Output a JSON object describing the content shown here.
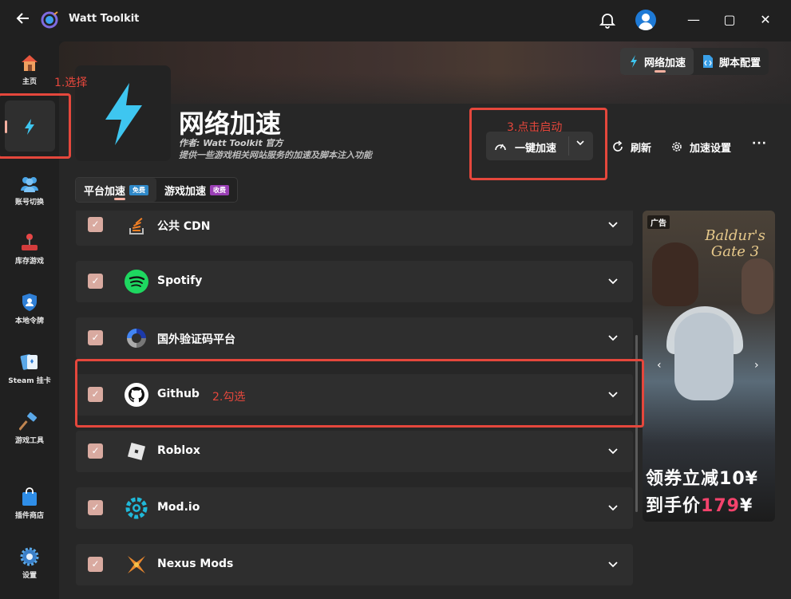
{
  "window": {
    "title": "Watt Toolkit",
    "controls": {
      "minimize": "—",
      "maximize": "▢",
      "close": "✕"
    }
  },
  "sidebar": {
    "items": [
      {
        "label": "主页",
        "icon": "home-icon"
      },
      {
        "label": "",
        "icon": "lightning-icon",
        "active": true
      },
      {
        "label": "账号切换",
        "icon": "users-icon"
      },
      {
        "label": "库存游戏",
        "icon": "joystick-icon"
      },
      {
        "label": "本地令牌",
        "icon": "shield-icon"
      },
      {
        "label": "Steam 挂卡",
        "icon": "cards-icon"
      },
      {
        "label": "游戏工具",
        "icon": "hammer-icon"
      },
      {
        "label": "插件商店",
        "icon": "shopping-bag-icon"
      },
      {
        "label": "设置",
        "icon": "gear-icon"
      }
    ]
  },
  "header": {
    "title": "网络加速",
    "author": "作者:  Watt Toolkit  官方",
    "description": "提供一些游戏相关网站服务的加速及脚本注入功能",
    "top_tabs": [
      {
        "label": "网络加速",
        "active": true
      },
      {
        "label": "脚本配置",
        "active": false
      }
    ],
    "accelerate_button": "一键加速",
    "refresh_button": "刷新",
    "settings_button": "加速设置",
    "more_button": "···"
  },
  "sub_tabs": [
    {
      "label": "平台加速",
      "badge": "免费",
      "active": true
    },
    {
      "label": "游戏加速",
      "badge": "收费",
      "active": false
    }
  ],
  "list": {
    "rows": [
      {
        "label": "公共 CDN",
        "checked": true,
        "icon": "stackoverflow-icon"
      },
      {
        "label": "Spotify",
        "checked": true,
        "icon": "spotify-icon"
      },
      {
        "label": "国外验证码平台",
        "checked": true,
        "icon": "recaptcha-icon"
      },
      {
        "label": "Github",
        "checked": true,
        "icon": "github-icon"
      },
      {
        "label": "Roblox",
        "checked": true,
        "icon": "roblox-icon"
      },
      {
        "label": "Mod.io",
        "checked": true,
        "icon": "modio-icon"
      },
      {
        "label": "Nexus Mods",
        "checked": true,
        "icon": "nexusmods-icon"
      }
    ]
  },
  "ad": {
    "tag": "广告",
    "logo": "Baldur's Gate 3",
    "line1_prefix": "领券立减",
    "line1_value": "10",
    "line1_suffix": "¥",
    "line2_prefix": "到手价",
    "line2_value": "179",
    "line2_suffix": "¥"
  },
  "annotations": {
    "step1": "1.选择",
    "step2": "2.勾选",
    "step3": "3.点击启动"
  },
  "colors": {
    "annotation": "#e5473c",
    "accent": "#f5b0a0",
    "lightning": "#3ec6f0",
    "checkbox": "#d9aaa0"
  }
}
